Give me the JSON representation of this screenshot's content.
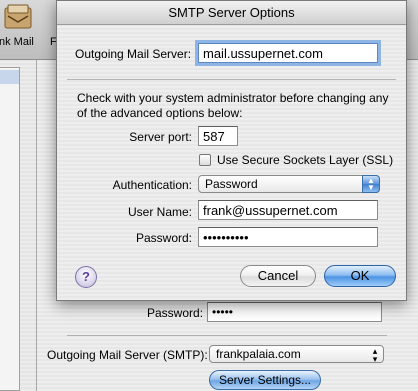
{
  "background": {
    "toolbar": {
      "items": [
        {
          "label": "nk Mail",
          "icon": "mail-app-icon"
        },
        {
          "label": "F",
          "icon": ""
        }
      ]
    },
    "account_panel": {
      "password_label": "Password:",
      "password_value": "•••••",
      "smtp_label": "Outgoing Mail Server (SMTP):",
      "smtp_value": "frankpalaia.com",
      "server_settings_button": "Server Settings..."
    }
  },
  "sheet": {
    "title": "SMTP Server Options",
    "outgoing_server_label": "Outgoing Mail Server:",
    "outgoing_server_value": "mail.ussupernet.com",
    "help_text": "Check with your system administrator before changing any of the advanced options below:",
    "server_port_label": "Server port:",
    "server_port_value": "587",
    "ssl_label": "Use Secure Sockets Layer (SSL)",
    "ssl_checked": false,
    "authentication_label": "Authentication:",
    "authentication_value": "Password",
    "user_name_label": "User Name:",
    "user_name_value": "frank@ussupernet.com",
    "password_label": "Password:",
    "password_value": "••••••••••",
    "help_button": "?",
    "cancel_button": "Cancel",
    "ok_button": "OK"
  },
  "colors": {
    "accent_blue": "#4d94e3",
    "focus_ring": "#8fb5e4",
    "help_purple": "#5a3fa0"
  }
}
